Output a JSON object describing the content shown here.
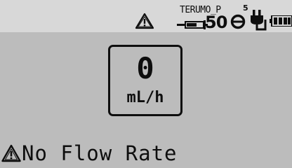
{
  "status_bar": {
    "warning_icon": "warning-triangle-icon",
    "syringe_brand": "TERUMO_P",
    "syringe_size": "50",
    "occlusion_level": "5",
    "icons": [
      "syringe-icon",
      "occlusion-pressure-icon",
      "ac-power-plug-icon",
      "battery-icon"
    ]
  },
  "rate_display": {
    "value": "0",
    "unit": "mL/h"
  },
  "alarm": {
    "icon": "warning-triangle-icon",
    "message": "No Flow Rate"
  },
  "colors": {
    "background": "#bcbcbc",
    "status_bar": "#d8d8d8",
    "foreground": "#0e0e0e"
  }
}
